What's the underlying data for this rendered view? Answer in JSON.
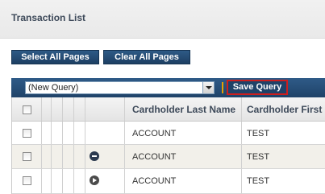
{
  "header": {
    "title": "Transaction List"
  },
  "toolbar": {
    "select_all_label": "Select All Pages",
    "clear_all_label": "Clear All Pages"
  },
  "query": {
    "selected": "(New Query)",
    "save_label": "Save Query"
  },
  "table": {
    "columns": [
      "Cardholder Last Name",
      "Cardholder First"
    ],
    "rows": [
      {
        "last": "ACCOUNT",
        "first": "TEST",
        "icon": ""
      },
      {
        "last": "ACCOUNT",
        "first": "TEST",
        "icon": "minus-circle-icon"
      },
      {
        "last": "ACCOUNT",
        "first": "TEST",
        "icon": "arrow-right-circle-icon"
      }
    ]
  },
  "colors": {
    "accent_blue": "#1f4268",
    "highlight_red": "#cc1e1e",
    "separator_orange": "#e6a000"
  }
}
